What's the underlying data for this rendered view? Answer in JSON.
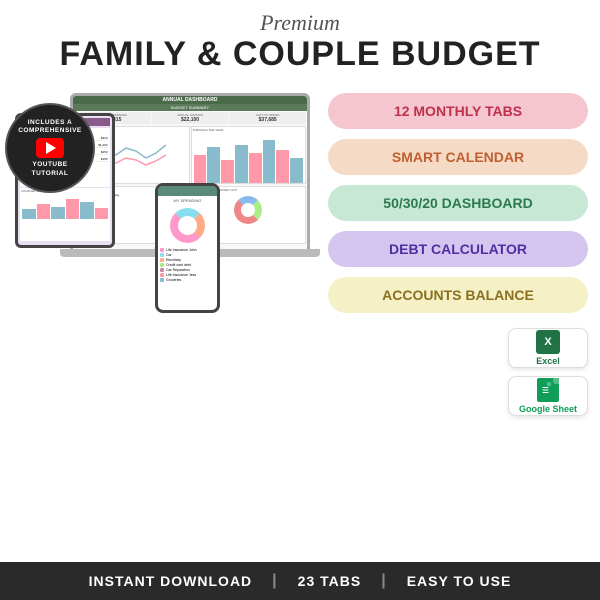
{
  "header": {
    "premium_label": "Premium",
    "main_title": "FAMILY & COUPLE BUDGET"
  },
  "badge": {
    "line1": "INCLUDES A COMPREHENSIVE",
    "line2": "YOUTUBE TUTORIAL"
  },
  "features": [
    {
      "id": "monthly-tabs",
      "label": "12 MONTHLY TABS",
      "style": "pill-pink"
    },
    {
      "id": "smart-calendar",
      "label": "SMART CALENDAR",
      "style": "pill-peach"
    },
    {
      "id": "5030-dashboard",
      "label": "50/30/20 DASHBOARD",
      "style": "pill-mint"
    },
    {
      "id": "debt-calculator",
      "label": "DEBT CALCULATOR",
      "style": "pill-lavender"
    },
    {
      "id": "accounts-balance",
      "label": "ACCOUNTS BALANCE",
      "style": "pill-yellow"
    }
  ],
  "app_badges": [
    {
      "id": "excel",
      "label": "Excel"
    },
    {
      "id": "google-sheet",
      "label": "Google Sheet"
    }
  ],
  "bottom_bar": {
    "item1": "INSTANT DOWNLOAD",
    "item2": "23 TABS",
    "item3": "EASY TO USE"
  },
  "dashboard": {
    "title": "ANNUAL DASHBOARD",
    "subtitle": "BUDGET SUMMARY",
    "annual_expenses_label": "ANNUAL EXPENSES",
    "annual_expenses_value": "$53,415",
    "annual_savings_label": "ANNUAL SAVINGS",
    "annual_savings_value": "$22,100",
    "left_to_spend_label": "LEFT TO SPEND",
    "left_to_spend_value": "$37,685"
  }
}
